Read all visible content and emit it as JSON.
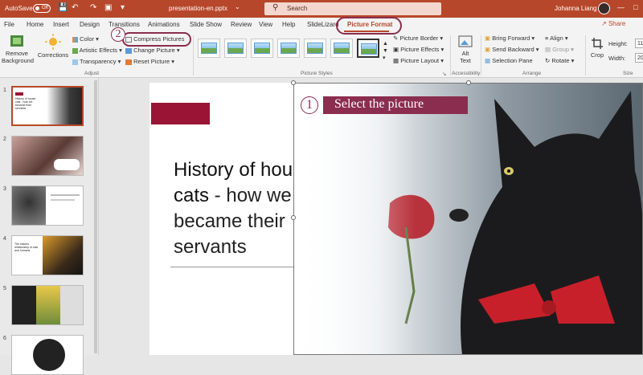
{
  "titlebar": {
    "autosave_label": "AutoSave",
    "autosave_state": "Off",
    "filename": "presentation-en.pptx",
    "filename_chevron": "⌄",
    "search_placeholder": "Search",
    "user_name": "Johanna Liang"
  },
  "tabs": [
    "File",
    "Home",
    "Insert",
    "Design",
    "Transitions",
    "Animations",
    "Slide Show",
    "Review",
    "View",
    "Help",
    "SlideLizard",
    "Picture Format"
  ],
  "active_tab": "Picture Format",
  "share_label": "Share",
  "ribbon": {
    "remove_background": "Remove Background",
    "corrections": "Corrections",
    "color": "Color",
    "artistic_effects": "Artistic Effects",
    "transparency": "Transparency",
    "compress_pictures": "Compress Pictures",
    "change_picture": "Change Picture",
    "reset_picture": "Reset Picture",
    "adjust_group": "Adjust",
    "picture_border": "Picture Border",
    "picture_effects": "Picture Effects",
    "picture_layout": "Picture Layout",
    "picture_styles_group": "Picture Styles",
    "alt_text": "Alt Text",
    "accessibility_group": "Accessibility",
    "bring_forward": "Bring Forward",
    "send_backward": "Send Backward",
    "selection_pane": "Selection Pane",
    "align": "Align",
    "group": "Group",
    "rotate": "Rotate",
    "arrange_group": "Arrange",
    "crop": "Crop",
    "height_label": "Height:",
    "width_label": "Width:",
    "height_value": "11",
    "width_value": "20",
    "size_group": "Size"
  },
  "slides": [
    {
      "number": "1",
      "caption": "History of house cats - how we became their servants"
    },
    {
      "number": "2",
      "caption": ""
    },
    {
      "number": "3",
      "caption": ""
    },
    {
      "number": "4",
      "caption": "The historic relationship of cats and humans"
    },
    {
      "number": "5",
      "caption": ""
    },
    {
      "number": "6",
      "caption": ""
    }
  ],
  "slide": {
    "title_bold": "History of house cats",
    "title_rest": " - how we became their servants"
  },
  "annotations": {
    "step1_number": "1",
    "step1_text": "Select the picture",
    "step2_number": "2"
  },
  "colors": {
    "accent": "#b7472a",
    "annotation": "#8b2d4e",
    "slide_block": "#9a1535"
  }
}
